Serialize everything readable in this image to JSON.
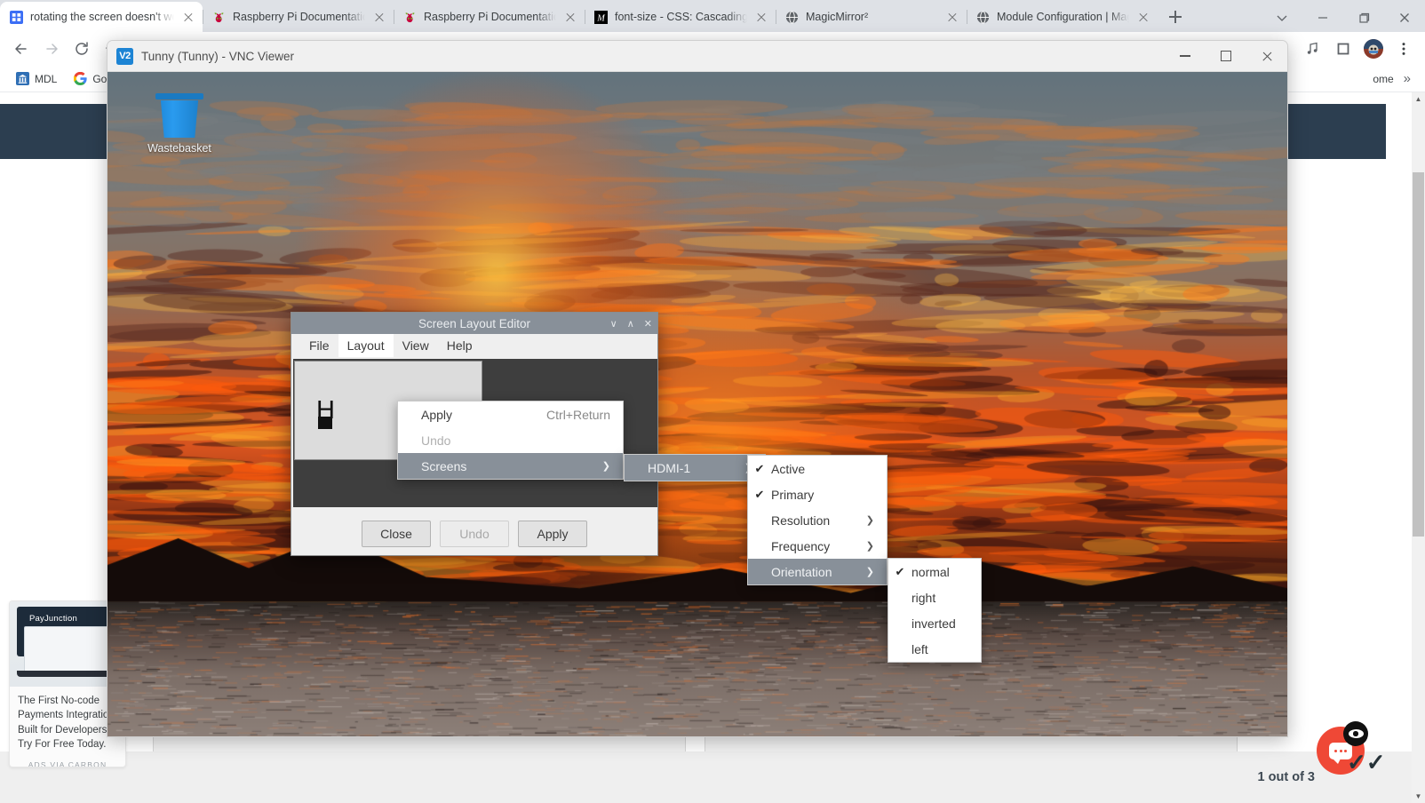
{
  "browser": {
    "tabs": [
      {
        "title": "rotating the screen doesn't wo",
        "favicon": "stackoverflow-icon",
        "active": true
      },
      {
        "title": "Raspberry Pi Documentation -",
        "favicon": "raspberry-pi-icon",
        "active": false
      },
      {
        "title": "Raspberry Pi Documentation -",
        "favicon": "raspberry-pi-icon",
        "active": false
      },
      {
        "title": "font-size - CSS: Cascading Sty",
        "favicon": "mdn-icon",
        "active": false
      },
      {
        "title": "MagicMirror²",
        "favicon": "globe-icon",
        "active": false
      },
      {
        "title": "Module Configuration | Magic",
        "favicon": "globe-icon",
        "active": false
      }
    ],
    "new_tab_label": "+",
    "window_controls": {
      "tab_search": "∨",
      "minimize": "—",
      "maximize": "❐",
      "close": "✕"
    },
    "toolbar": {
      "back": "←",
      "forward": "→",
      "reload": "⟳",
      "home": "⌂",
      "media_icon": "media-control-icon",
      "extensions_icon": "extensions-icon",
      "profile_icon": "profile-avatar",
      "menu_icon": "⋮"
    },
    "bookmarks": [
      {
        "label": "MDL",
        "icon": "bank-icon"
      },
      {
        "label": "Go",
        "icon": "google-icon"
      }
    ],
    "bookmark_right": "ome",
    "bookmark_overflow": "»"
  },
  "page": {
    "pager_text": "1 out of 3",
    "carbon_ad": {
      "brand": "PayJunction",
      "body": "The First No-code Payments Integration Built for Developers. Try For Free Today.",
      "footer": "ADS VIA CARBON"
    },
    "feedback": {
      "name": "feedback-bubble"
    }
  },
  "vnc": {
    "title": "Tunny (Tunny) - VNC Viewer",
    "logo_text": "V2",
    "controls": {
      "minimize": "minimize",
      "maximize": "maximize",
      "close": "close"
    },
    "desktop": {
      "wastebasket_label": "Wastebasket"
    }
  },
  "screen_layout_editor": {
    "title": "Screen Layout Editor",
    "title_buttons": {
      "shade": "∨",
      "unshade": "∧",
      "close": "✕"
    },
    "menubar": [
      {
        "label": "File",
        "open": false
      },
      {
        "label": "Layout",
        "open": true
      },
      {
        "label": "View",
        "open": false
      },
      {
        "label": "Help",
        "open": false
      }
    ],
    "canvas": {
      "screen_label": "H"
    },
    "buttons": [
      {
        "label": "Close",
        "disabled": false
      },
      {
        "label": "Undo",
        "disabled": true
      },
      {
        "label": "Apply",
        "disabled": false
      }
    ],
    "layout_menu": [
      {
        "label": "Apply",
        "accel": "Ctrl+Return",
        "disabled": false,
        "selected": false,
        "submenu": false
      },
      {
        "label": "Undo",
        "accel": "",
        "disabled": true,
        "selected": false,
        "submenu": false
      },
      {
        "label": "Screens",
        "accel": "",
        "disabled": false,
        "selected": true,
        "submenu": true
      }
    ],
    "screens_menu": [
      {
        "label": "HDMI-1",
        "selected": true,
        "submenu": true
      }
    ],
    "screen_options_menu": [
      {
        "label": "Active",
        "checked": true,
        "submenu": false,
        "selected": false
      },
      {
        "label": "Primary",
        "checked": true,
        "submenu": false,
        "selected": false
      },
      {
        "label": "Resolution",
        "checked": false,
        "submenu": true,
        "selected": false
      },
      {
        "label": "Frequency",
        "checked": false,
        "submenu": true,
        "selected": false
      },
      {
        "label": "Orientation",
        "checked": false,
        "submenu": true,
        "selected": true
      }
    ],
    "orientation_menu": [
      {
        "label": "normal",
        "checked": true
      },
      {
        "label": "right",
        "checked": false
      },
      {
        "label": "inverted",
        "checked": false
      },
      {
        "label": "left",
        "checked": false
      }
    ]
  },
  "colors": {
    "tabstrip": "#dee1e6",
    "hero": "#2c3e50",
    "menu_highlight": "#889099",
    "sle_canvas": "#3e3e3e",
    "accent_red": "#ef4836"
  }
}
